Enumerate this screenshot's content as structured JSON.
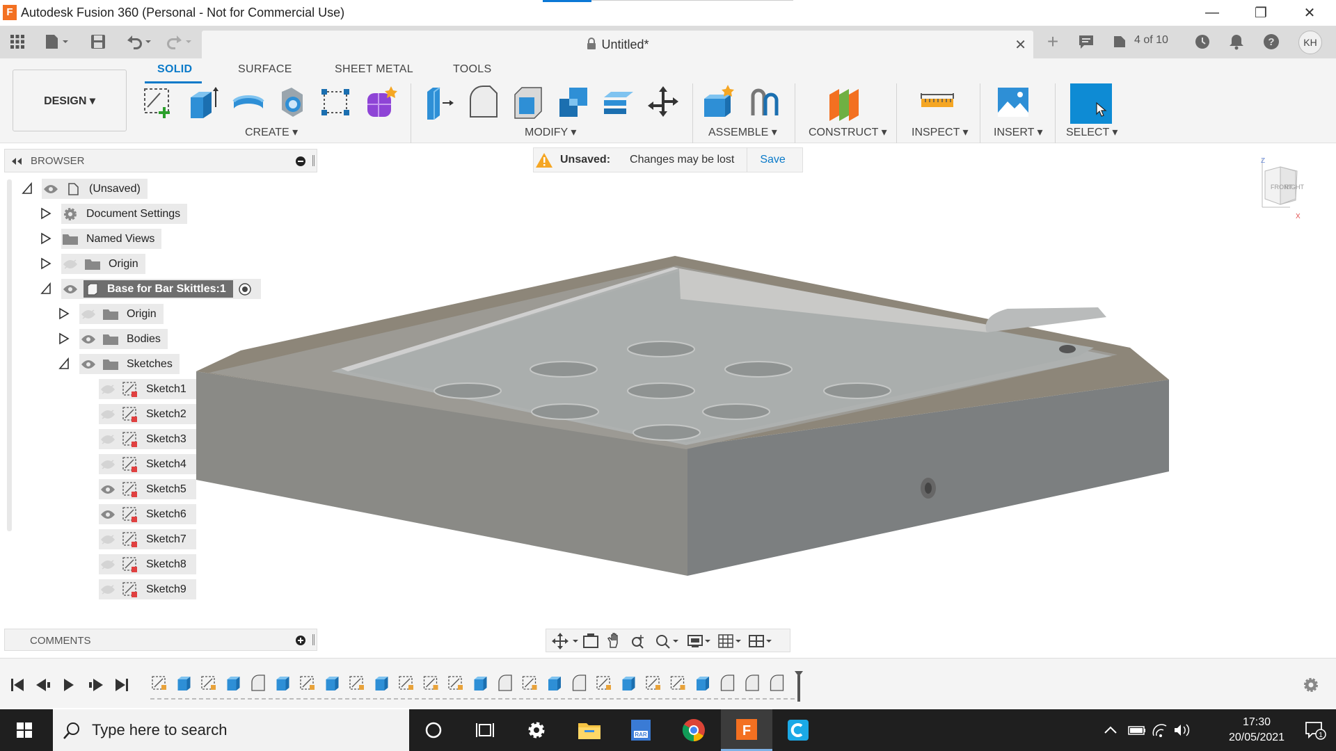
{
  "window": {
    "app_logo": "F",
    "title": "Autodesk Fusion 360 (Personal - Not for Commercial Use)",
    "min": "—",
    "restore": "❐",
    "close": "✕"
  },
  "appbar": {
    "doc_name": "Untitled*",
    "close": "✕",
    "version": "4 of 10",
    "avatar": "KH"
  },
  "ribbon": {
    "tabs": [
      "SOLID",
      "SURFACE",
      "SHEET METAL",
      "TOOLS"
    ],
    "active_tab": "SOLID",
    "design_label": "DESIGN ▾",
    "groups": [
      "CREATE ▾",
      "MODIFY ▾",
      "ASSEMBLE ▾",
      "CONSTRUCT ▾",
      "INSPECT ▾",
      "INSERT ▾",
      "SELECT ▾"
    ]
  },
  "browser": {
    "title": "BROWSER",
    "root": "(Unsaved)",
    "document_settings": "Document Settings",
    "named_views": "Named Views",
    "origin": "Origin",
    "component": "Base for Bar Skittles:1",
    "comp_origin": "Origin",
    "bodies": "Bodies",
    "sketches": "Sketches",
    "sketch_items": [
      "Sketch1",
      "Sketch2",
      "Sketch3",
      "Sketch4",
      "Sketch5",
      "Sketch6",
      "Sketch7",
      "Sketch8",
      "Sketch9"
    ],
    "sketch_visible": [
      false,
      false,
      false,
      false,
      true,
      true,
      false,
      false,
      false
    ]
  },
  "comments": {
    "title": "COMMENTS"
  },
  "notice": {
    "label": "Unsaved:",
    "message": "Changes may be lost",
    "save": "Save"
  },
  "viewcube": {
    "front": "FRONT",
    "right": "RIGHT",
    "z": "Z",
    "x": "X"
  },
  "taskbar": {
    "search_placeholder": "Type here to search",
    "time": "17:30",
    "date": "20/05/2021",
    "notifications": "1"
  },
  "colors": {
    "accent": "#0a7ac9",
    "select_blue": "#0e8bd4",
    "taskbar": "#1f1f1f"
  }
}
